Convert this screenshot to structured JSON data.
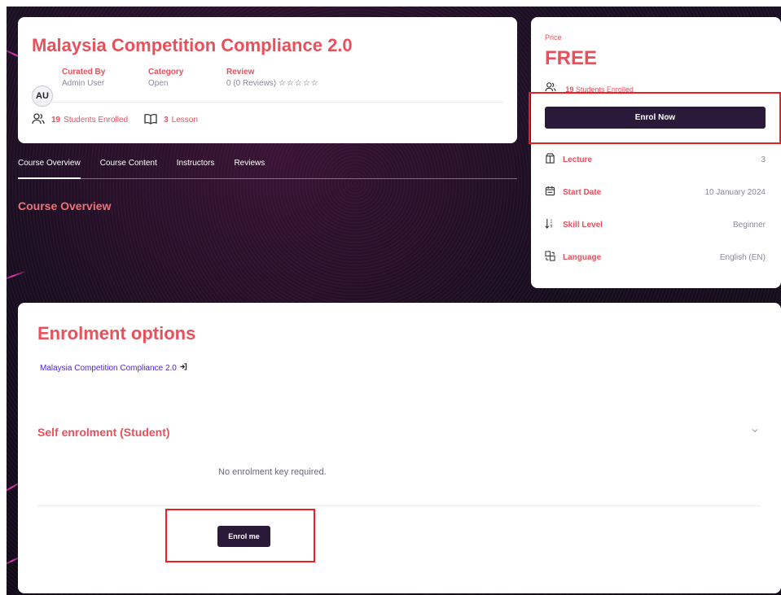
{
  "course": {
    "title": "Malaysia Competition Compliance 2.0",
    "avatar_initials": "AU",
    "curated_by_label": "Curated By",
    "curated_by_value": "Admin User",
    "category_label": "Category",
    "category_value": "Open",
    "review_label": "Review",
    "review_value": "0 (0 Reviews)",
    "stars": "☆☆☆☆☆",
    "students_count": "19",
    "students_label": "Students Enrolled",
    "lessons_count": "3",
    "lessons_label": "Lesson"
  },
  "tabs": [
    {
      "label": "Course Overview"
    },
    {
      "label": "Course Content"
    },
    {
      "label": "Instructors"
    },
    {
      "label": "Reviews"
    }
  ],
  "overview_heading": "Course Overview",
  "sidebar": {
    "price_label": "Price",
    "price_value": "FREE",
    "students_count": "19",
    "students_label": "Students Enrolled",
    "enrol_button": "Enrol Now",
    "info": [
      {
        "label": "Lecture",
        "value": "3",
        "icon": "cube-icon"
      },
      {
        "label": "Start Date",
        "value": "10 January 2024",
        "icon": "calendar-icon"
      },
      {
        "label": "Skill Level",
        "value": "Beginner",
        "icon": "sort-icon"
      },
      {
        "label": "Language",
        "value": "English (EN)",
        "icon": "translate-icon"
      }
    ]
  },
  "enrolment": {
    "title": "Enrolment options",
    "course_link": "Malaysia Competition Compliance 2.0",
    "self_title": "Self enrolment (Student)",
    "no_key_text": "No enrolment key required.",
    "enrol_button": "Enrol me"
  },
  "colors": {
    "accent": "#e8505b",
    "button": "#2a1939",
    "highlight": "#ef1c24",
    "link": "#4a1fd6"
  }
}
